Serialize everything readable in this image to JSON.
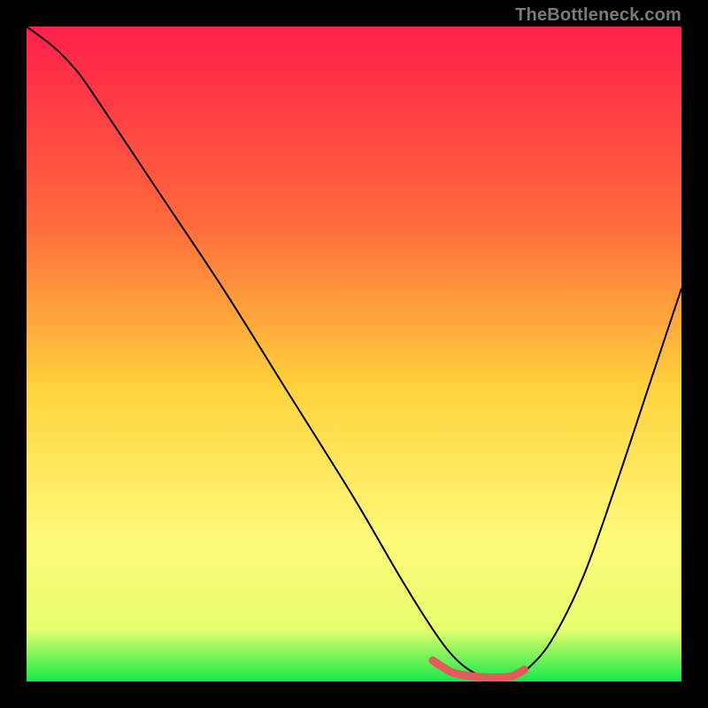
{
  "watermark": "TheBottleneck.com",
  "chart_data": {
    "type": "line",
    "title": "",
    "xlabel": "",
    "ylabel": "",
    "xlim": [
      0,
      100
    ],
    "ylim": [
      0,
      100
    ],
    "gradient_stops": [
      {
        "offset": 0,
        "color": "#ff1f4b"
      },
      {
        "offset": 30,
        "color": "#ff6a3c"
      },
      {
        "offset": 55,
        "color": "#ffd23c"
      },
      {
        "offset": 78,
        "color": "#fff97a"
      },
      {
        "offset": 92,
        "color": "#e7ff6e"
      },
      {
        "offset": 100,
        "color": "#17e84a"
      }
    ],
    "series": [
      {
        "name": "bottleneck-curve",
        "color": "#000000",
        "width": 2.0,
        "x": [
          0,
          4,
          7,
          10,
          20,
          30,
          40,
          50,
          57,
          62,
          65,
          68,
          71,
          74,
          76,
          80,
          85,
          90,
          95,
          100
        ],
        "y": [
          100,
          97,
          94,
          90,
          75,
          60,
          44,
          28,
          16,
          8,
          4,
          1.5,
          0.5,
          0.5,
          1.5,
          6,
          16,
          30,
          45,
          60
        ]
      },
      {
        "name": "highlight-band",
        "color": "#e55a5a",
        "width": 9,
        "linecap": "round",
        "x": [
          62,
          65,
          68,
          71,
          74,
          76
        ],
        "y": [
          3.2,
          1.4,
          0.8,
          0.6,
          0.8,
          1.8
        ]
      }
    ]
  }
}
